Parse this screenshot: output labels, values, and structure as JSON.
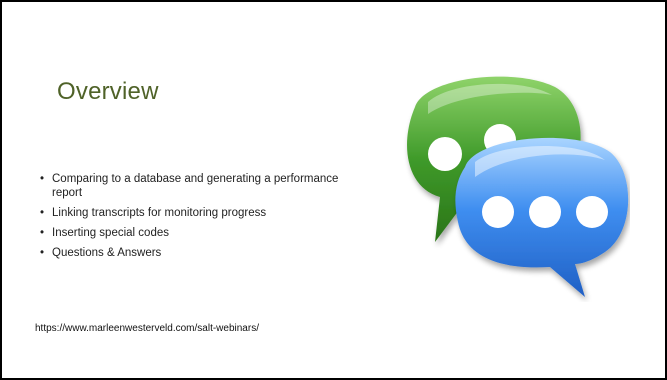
{
  "slide": {
    "title": "Overview",
    "bullets": [
      "Comparing to a database and generating a performance report",
      "Linking transcripts for monitoring progress",
      "Inserting special codes",
      "Questions & Answers"
    ],
    "url": "https://www.marleenwesterveld.com/salt-webinars/",
    "illustration": {
      "icon": "chat-bubbles-icon",
      "colors": {
        "green": "#3f9a2a",
        "blue": "#2f7be0"
      }
    },
    "title_color": "#4f6228"
  }
}
